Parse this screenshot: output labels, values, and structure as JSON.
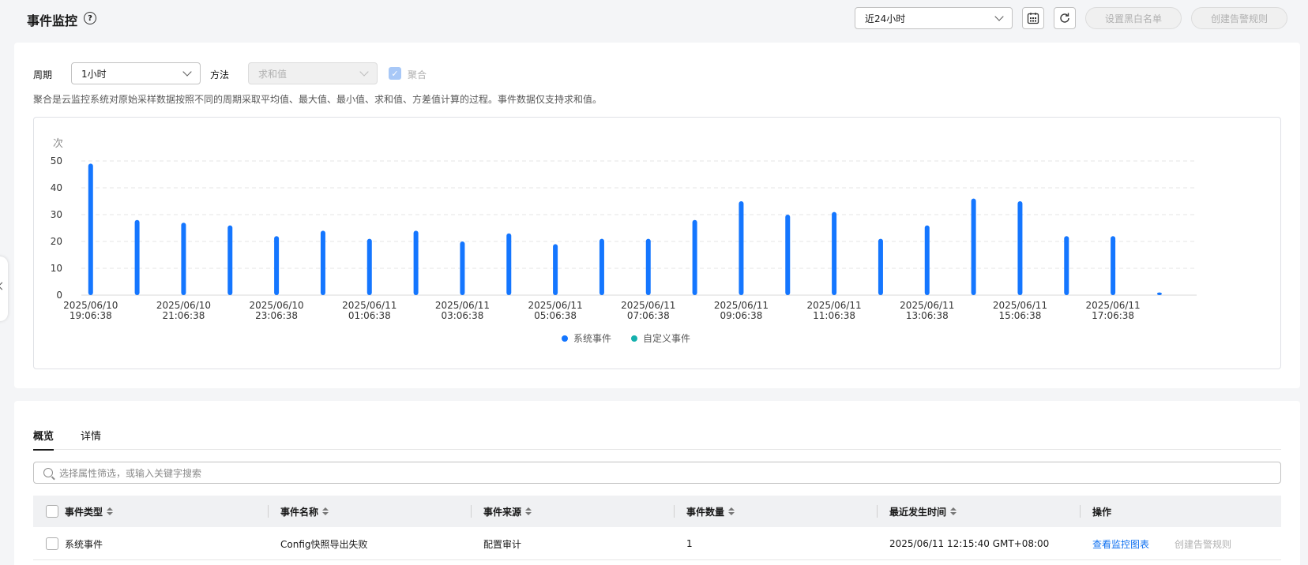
{
  "header": {
    "title": "事件监控",
    "help_glyph": "?",
    "time_range": "近24小时",
    "blacklist_button": "设置黑白名单",
    "create_alarm_button": "创建告警规则"
  },
  "filters": {
    "period_label": "周期",
    "period_value": "1小时",
    "method_label": "方法",
    "method_value": "求和值",
    "aggregate_label": "聚合",
    "hint": "聚合是云监控系统对原始采样数据按照不同的周期采取平均值、最大值、最小值、求和值、方差值计算的过程。事件数据仅支持求和值。"
  },
  "chart_data": {
    "type": "bar",
    "ylabel": "次",
    "ylim": [
      0,
      50
    ],
    "yticks": [
      0,
      10,
      20,
      30,
      40,
      50
    ],
    "grid": true,
    "legend_position": "bottom",
    "x_tick_labels": [
      [
        "2025/06/10",
        "19:06:38"
      ],
      [
        "2025/06/10",
        "21:06:38"
      ],
      [
        "2025/06/10",
        "23:06:38"
      ],
      [
        "2025/06/11",
        "01:06:38"
      ],
      [
        "2025/06/11",
        "03:06:38"
      ],
      [
        "2025/06/11",
        "05:06:38"
      ],
      [
        "2025/06/11",
        "07:06:38"
      ],
      [
        "2025/06/11",
        "09:06:38"
      ],
      [
        "2025/06/11",
        "11:06:38"
      ],
      [
        "2025/06/11",
        "13:06:38"
      ],
      [
        "2025/06/11",
        "15:06:38"
      ],
      [
        "2025/06/11",
        "17:06:38"
      ]
    ],
    "series": [
      {
        "name": "系统事件",
        "color": "#1476ff",
        "values": [
          49,
          28,
          27,
          26,
          22,
          24,
          21,
          24,
          20,
          23,
          19,
          21,
          21,
          28,
          35,
          30,
          31,
          21,
          26,
          36,
          35,
          22,
          22,
          1
        ]
      },
      {
        "name": "自定义事件",
        "color": "#15b0ad",
        "values": [
          0,
          0,
          0,
          0,
          0,
          0,
          0,
          0,
          0,
          0,
          0,
          0,
          0,
          0,
          0,
          0,
          0,
          0,
          0,
          0,
          0,
          0,
          0,
          0
        ]
      }
    ]
  },
  "tabs": [
    "概览",
    "详情"
  ],
  "search": {
    "placeholder": "选择属性筛选，或输入关键字搜索"
  },
  "table": {
    "columns": [
      "事件类型",
      "事件名称",
      "事件来源",
      "事件数量",
      "最近发生时间",
      "操作"
    ],
    "rows": [
      {
        "type": "系统事件",
        "name": "Config快照导出失败",
        "source": "配置审计",
        "count": "1",
        "time": "2025/06/11 12:15:40 GMT+08:00",
        "action_view": "查看监控图表",
        "action_alarm": "创建告警规则"
      }
    ]
  },
  "colors": {
    "accent": "#1476ff",
    "link": "#0d6ff0",
    "custom": "#15b0ad"
  }
}
